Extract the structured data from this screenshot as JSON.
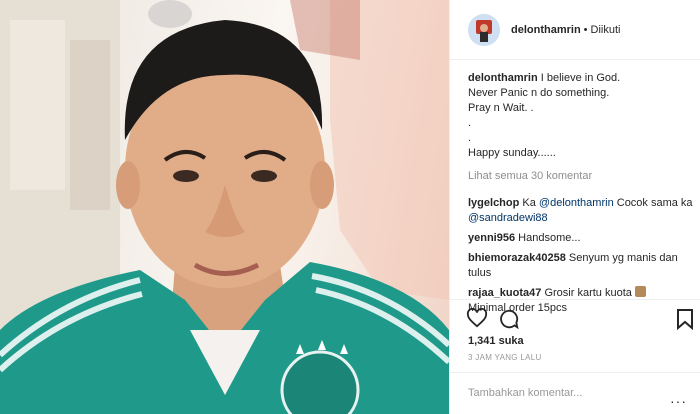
{
  "post": {
    "image_alt": "",
    "username": "delonthamrin",
    "follow_status": "Diikuti",
    "caption": {
      "username": "delonthamrin",
      "lines": [
        "I believe in God.",
        "Never Panic n do something.",
        "Pray n Wait. .",
        ".",
        ".",
        "Happy sunday......"
      ]
    },
    "view_all": "Lihat semua 30 komentar",
    "comments": [
      {
        "user": "lygelchop",
        "pre": "Ka ",
        "mention1": "@delonthamrin",
        "mid": " Cocok sama ka ",
        "mention2": "@sandradewi88"
      },
      {
        "user": "yenni956",
        "text": "Handsome..."
      },
      {
        "user": "bhiemorazak40258",
        "text": "Senyum yg manis dan tulus"
      },
      {
        "user": "rajaa_kuota47",
        "text": "Grosir kartu kuota",
        "text2": "Minimal order 15pcs"
      }
    ],
    "likes": "1,341 suka",
    "time": "3 JAM YANG LALU",
    "add_comment_placeholder": "Tambahkan komentar..."
  },
  "icons": {
    "like": "heart-icon",
    "comment": "comment-icon",
    "save": "bookmark-icon",
    "more": "more-icon"
  }
}
